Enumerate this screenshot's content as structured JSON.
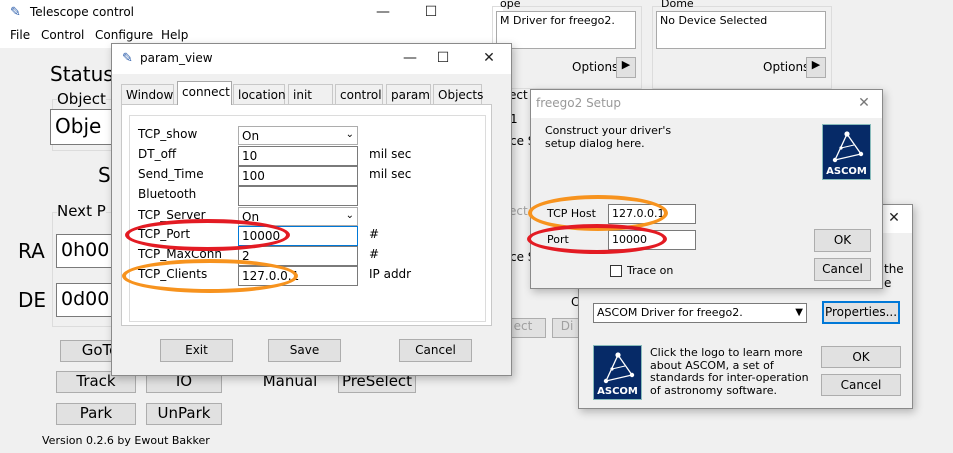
{
  "telescope_window": {
    "title": "Telescope control",
    "menu": [
      "File",
      "Control",
      "Configure",
      "Help"
    ],
    "status_label": "Status",
    "object_group_label": "Object",
    "object_value": "Obje",
    "sidereal_label": "S",
    "next_position_label": "Next P",
    "ra_label": "RA",
    "ra_value": "0h00",
    "de_label": "DE",
    "de_value": "0d00",
    "buttons": {
      "goto": "GoTo",
      "track": "Track",
      "io": "IO",
      "manual": "Manual",
      "preselect": "PreSelect",
      "park": "Park",
      "unpark": "UnPark"
    },
    "version": "Version 0.2.6 by Ewout Bakker"
  },
  "chooser_bg": {
    "telescope_header": "ope",
    "telescope_device": "M Driver for freego2.",
    "dome_header": "Dome",
    "dome_device": "No Device Selected",
    "options_label_1": "Options",
    "options_label_2": "Options",
    "partial_1": "ect",
    "partial_2": "ce S",
    "partial_3": "ect",
    "partial_4": "ce S",
    "partial_5": "ect",
    "partial_6": "Di",
    "partial_7": "C",
    "partial_8": "1",
    "partial_9": "Di"
  },
  "param_view": {
    "title": "param_view",
    "tabs": [
      "Window",
      "connect",
      "location",
      "init",
      "control",
      "param",
      "Objects"
    ],
    "active_tab": "connect",
    "rows": [
      {
        "label": "TCP_show",
        "value": "On",
        "unit": ""
      },
      {
        "label": "DT_off",
        "value": "10",
        "unit": "mil sec"
      },
      {
        "label": "Send_Time",
        "value": "100",
        "unit": "mil sec"
      },
      {
        "label": "Bluetooth",
        "value": "",
        "unit": ""
      },
      {
        "label": "TCP_Server",
        "value": "On",
        "unit": ""
      },
      {
        "label": "TCP_Port",
        "value": "10000",
        "unit": "#"
      },
      {
        "label": "TCP_MaxConn",
        "value": "2",
        "unit": "#"
      },
      {
        "label": "TCP_Clients",
        "value": "127.0.0.1",
        "unit": "IP addr"
      }
    ],
    "exit_label": "Exit",
    "save_label": "Save",
    "cancel_label": "Cancel"
  },
  "freego_setup": {
    "title": "freego2 Setup",
    "description": "Construct your driver's setup dialog here.",
    "logo_text": "ASCOM",
    "tcp_host_label": "TCP Host",
    "tcp_host_value": "127.0.0.1",
    "port_label": "Port",
    "port_value": "10000",
    "trace_label": "Trace on",
    "ok_label": "OK",
    "cancel_label": "Cancel"
  },
  "ascom_chooser": {
    "partial_text": "the",
    "partial_text_2": "e",
    "driver_select": "ASCOM Driver for freego2.",
    "properties_label": "Properties...",
    "info_text": "Click the logo to learn more about ASCOM, a set of standards for inter-operation of astronomy software.",
    "logo_text": "ASCOM",
    "ok_label": "OK",
    "cancel_label": "Cancel"
  },
  "annotation_colors": {
    "red": "#e31b23",
    "orange": "#f7931e"
  }
}
